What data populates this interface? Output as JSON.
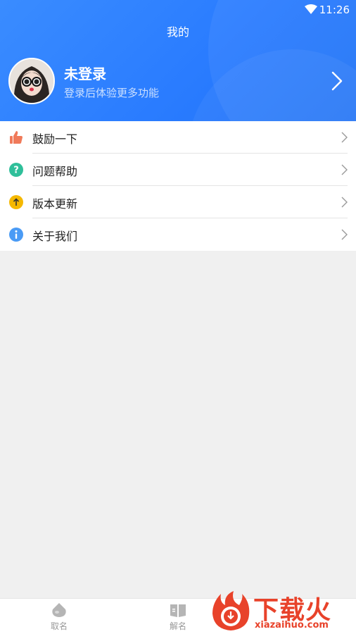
{
  "status_bar": {
    "time": "11:26",
    "wifi_icon": "wifi-icon"
  },
  "header": {
    "title": "我的",
    "user_name": "未登录",
    "user_subtitle": "登录后体验更多功能",
    "avatar": "avatar",
    "arrow_icon": "chevron-right-icon"
  },
  "menu": {
    "items": [
      {
        "label": "鼓励一下",
        "icon": "thumbs-up-icon",
        "color": "#f07a5a"
      },
      {
        "label": "问题帮助",
        "icon": "question-icon",
        "color": "#2fbf9a"
      },
      {
        "label": "版本更新",
        "icon": "upgrade-icon",
        "color": "#f5b800"
      },
      {
        "label": "关于我们",
        "icon": "info-icon",
        "color": "#4a9bf5"
      }
    ]
  },
  "tabbar": {
    "tabs": [
      {
        "label": "取名",
        "icon": "naming-icon"
      },
      {
        "label": "解名",
        "icon": "book-icon"
      }
    ]
  },
  "watermark": {
    "cn": "下载火",
    "en": "xiazaihuo.com"
  },
  "colors": {
    "header_blue": "#2a7cff",
    "background": "#f0f0f0",
    "watermark_red": "#e8422a"
  }
}
